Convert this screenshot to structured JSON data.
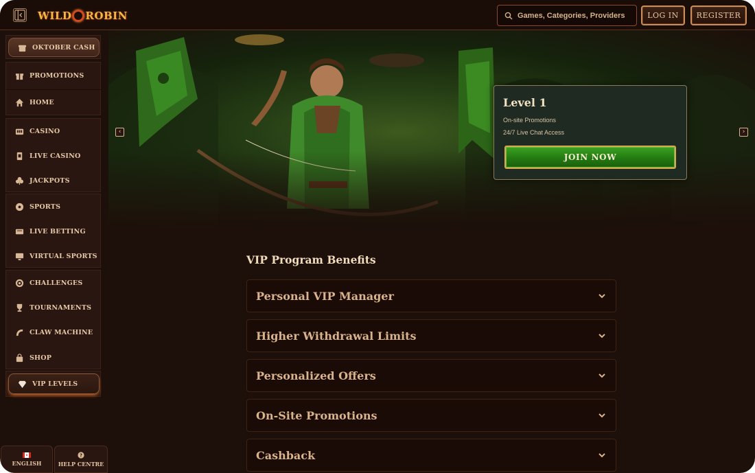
{
  "header": {
    "logo_left": "WILD",
    "logo_right": "ROBIN",
    "search_placeholder": "Games, Categories, Providers",
    "login_label": "LOG IN",
    "register_label": "REGISTER"
  },
  "sidebar": {
    "items": [
      {
        "label": "OKTOBER CASH",
        "icon": "gift-box-icon"
      },
      {
        "label": "PROMOTIONS",
        "icon": "gift-icon"
      },
      {
        "label": "HOME",
        "icon": "home-icon"
      },
      {
        "label": "CASINO",
        "icon": "slot-machine-icon"
      },
      {
        "label": "LIVE CASINO",
        "icon": "cards-icon"
      },
      {
        "label": "JACKPOTS",
        "icon": "clover-icon"
      },
      {
        "label": "SPORTS",
        "icon": "ball-icon"
      },
      {
        "label": "LIVE BETTING",
        "icon": "live-icon"
      },
      {
        "label": "VIRTUAL SPORTS",
        "icon": "monitor-icon"
      },
      {
        "label": "CHALLENGES",
        "icon": "target-icon"
      },
      {
        "label": "TOURNAMENTS",
        "icon": "trophy-icon"
      },
      {
        "label": "CLAW MACHINE",
        "icon": "claw-icon"
      },
      {
        "label": "SHOP",
        "icon": "bag-icon"
      },
      {
        "label": "VIP LEVELS",
        "icon": "diamond-icon"
      }
    ],
    "language_label": "ENGLISH",
    "help_label": "HELP CENTRE"
  },
  "hero": {
    "level_title": "Level 1",
    "benefits": [
      "On-site Promotions",
      "24/7 Live Chat Access"
    ],
    "join_label": "JOIN NOW"
  },
  "vip": {
    "title": "VIP Program Benefits",
    "accordions": [
      "Personal VIP Manager",
      "Higher Withdrawal Limits",
      "Personalized Offers",
      "On-Site Promotions",
      "Cashback"
    ]
  },
  "colors": {
    "background": "#1d0f0a",
    "accent_gold": "#c98e5c",
    "join_green": "#237a12",
    "text_tan": "#d9b38c"
  }
}
